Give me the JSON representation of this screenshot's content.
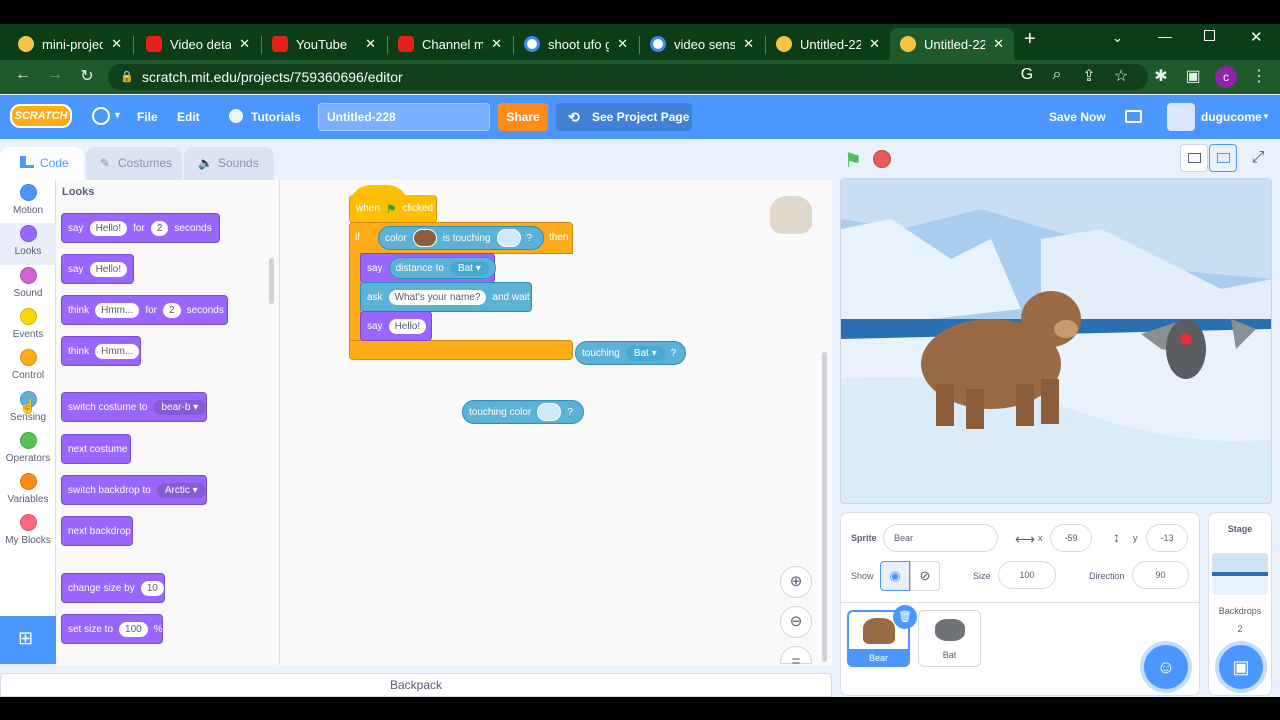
{
  "browser": {
    "tabs": [
      {
        "title": "mini-projec",
        "icon": "scratch-favicon"
      },
      {
        "title": "Video detai",
        "icon": "youtube-favicon"
      },
      {
        "title": "YouTube",
        "icon": "youtube-favicon"
      },
      {
        "title": "Channel mc",
        "icon": "youtube-favicon"
      },
      {
        "title": "shoot ufo g",
        "icon": "google-favicon"
      },
      {
        "title": "video sensi",
        "icon": "google-favicon"
      },
      {
        "title": "Untitled-22",
        "icon": "scratch-favicon"
      },
      {
        "title": "Untitled-22",
        "icon": "scratch-favicon"
      }
    ],
    "url": "scratch.mit.edu/projects/759360696/editor",
    "profile_initial": "c"
  },
  "menu": {
    "logo": "SCRATCH",
    "file": "File",
    "edit": "Edit",
    "tutorials": "Tutorials",
    "project_title": "Untitled-228",
    "share": "Share",
    "see_project_page": "See Project Page",
    "save_now": "Save Now",
    "username": "dugucome"
  },
  "tabs": {
    "code": "Code",
    "costumes": "Costumes",
    "sounds": "Sounds"
  },
  "categories": [
    {
      "label": "Motion",
      "color": "#4c97ff"
    },
    {
      "label": "Looks",
      "color": "#9966ff"
    },
    {
      "label": "Sound",
      "color": "#cf63cf"
    },
    {
      "label": "Events",
      "color": "#ffd500"
    },
    {
      "label": "Control",
      "color": "#ffab19"
    },
    {
      "label": "Sensing",
      "color": "#5cb1d6"
    },
    {
      "label": "Operators",
      "color": "#59c059"
    },
    {
      "label": "Variables",
      "color": "#ff8c1a"
    },
    {
      "label": "My Blocks",
      "color": "#ff6680"
    }
  ],
  "palette": {
    "heading": "Looks",
    "say_for": {
      "say": "say",
      "text": "Hello!",
      "for": "for",
      "secs": "2",
      "seconds": "seconds"
    },
    "say": {
      "say": "say",
      "text": "Hello!"
    },
    "think_for": {
      "think": "think",
      "text": "Hmm...",
      "for": "for",
      "secs": "2",
      "seconds": "seconds"
    },
    "think": {
      "think": "think",
      "text": "Hmm..."
    },
    "switch_costume": {
      "label": "switch costume to",
      "value": "bear-b"
    },
    "next_costume": "next costume",
    "switch_backdrop": {
      "label": "switch backdrop to",
      "value": "Arctic"
    },
    "next_backdrop": "next backdrop",
    "change_size": {
      "label": "change size by",
      "value": "10"
    },
    "set_size": {
      "label": "set size to",
      "value": "100",
      "unit": "%"
    }
  },
  "script": {
    "hat": {
      "when": "when",
      "clicked": "clicked"
    },
    "if": {
      "if": "if",
      "color": "color",
      "is_touching": "is touching",
      "q": "?",
      "then": "then",
      "swatch": "#8b5e3c"
    },
    "say_distance": {
      "say": "say",
      "distance_to": "distance to",
      "target": "Bat"
    },
    "ask": {
      "ask": "ask",
      "text": "What's your name?",
      "and_wait": "and wait"
    },
    "say_hello": {
      "say": "say",
      "text": "Hello!"
    },
    "touching": {
      "label": "touching",
      "target": "Bat",
      "q": "?"
    },
    "touching_color": {
      "label": "touching color",
      "q": "?"
    }
  },
  "sprite_info": {
    "sprite_label": "Sprite",
    "name": "Bear",
    "x_label": "x",
    "x": "-59",
    "y_label": "y",
    "y": "-13",
    "show_label": "Show",
    "size_label": "Size",
    "size": "100",
    "direction_label": "Direction",
    "direction": "90"
  },
  "sprites": [
    {
      "name": "Bear",
      "selected": true
    },
    {
      "name": "Bat",
      "selected": false
    }
  ],
  "stage_panel": {
    "title": "Stage",
    "backdrops_label": "Backdrops",
    "backdrops_count": "2"
  },
  "backpack": "Backpack"
}
